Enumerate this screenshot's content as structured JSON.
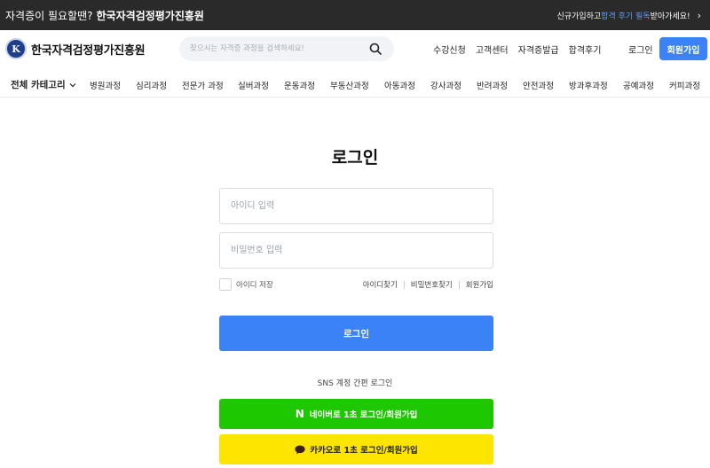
{
  "top_banner": {
    "question": "자격증이 필요할땐?",
    "brand": "한국자격검정평가진흥원",
    "promo_prefix": "신규가입하고 ",
    "promo_highlight": "합격 후기 필독",
    "promo_suffix": " 받아가세요!"
  },
  "header": {
    "logo_letter": "K",
    "logo_name": "한국자격검정평가진흥원",
    "search_placeholder": "찾으시는 자격증 과정을 검색하세요!",
    "nav_links": [
      "수강신청",
      "고객센터",
      "자격증발급",
      "합격후기"
    ],
    "login_label": "로그인",
    "join_label": "회원가입"
  },
  "category_nav": {
    "all_label": "전체 카테고리",
    "items": [
      "병원과정",
      "심리과정",
      "전문가 과정",
      "실버과정",
      "운동과정",
      "부동산과정",
      "아동과정",
      "강사과정",
      "반려과정",
      "안전과정",
      "방과후과정",
      "공예과정",
      "커피과정"
    ]
  },
  "login": {
    "title": "로그인",
    "id_placeholder": "아이디 입력",
    "password_placeholder": "비밀번호 입력",
    "remember_label": "아이디 저장",
    "find_id": "아이디찾기",
    "find_password": "비밀번호찾기",
    "signup": "회원가입",
    "submit_label": "로그인",
    "sns_title": "SNS 계정 간편 로그인",
    "naver_letter": "N",
    "naver_label": "네이버로 1초 로그인/회원가입",
    "kakao_label": "카카오로 1초 로그인/회원가입"
  },
  "colors": {
    "banner_bg": "#2a2a2a",
    "accent_blue": "#3b82f6",
    "naver_green": "#1ec800",
    "kakao_yellow": "#fee500"
  },
  "icons": {
    "search": "search-icon",
    "chevron": "chevron-down-icon",
    "arrow": "chevron-right-icon",
    "naver": "naver-icon",
    "kakao": "kakao-talk-icon"
  }
}
